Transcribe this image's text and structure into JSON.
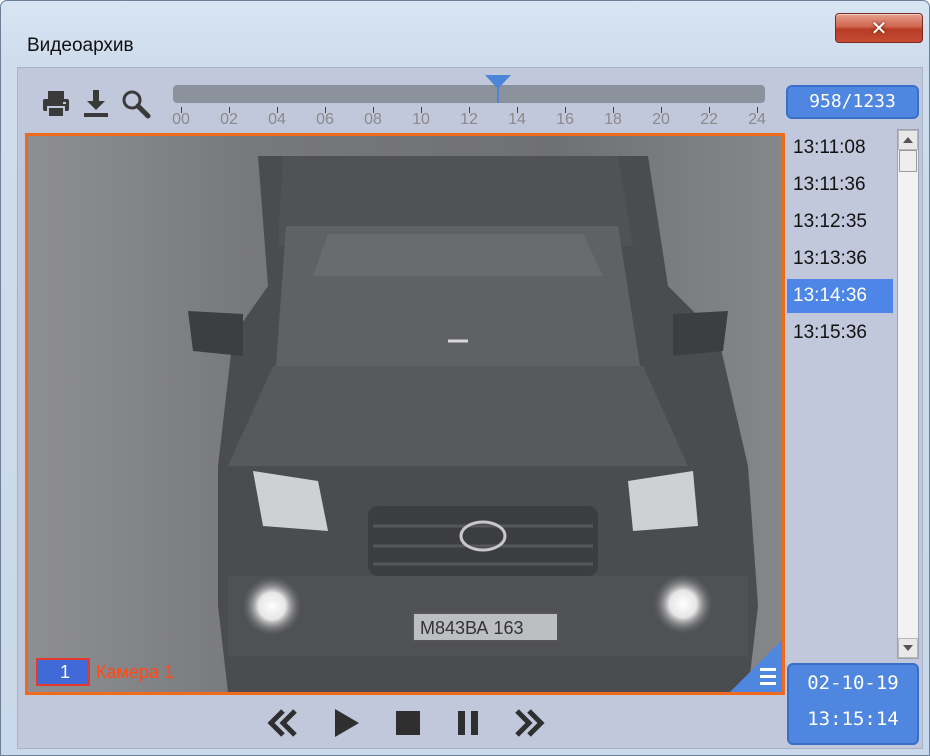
{
  "window": {
    "title": "Видеоархив",
    "close_label": "✕"
  },
  "toolbar": {
    "print_icon": "printer-icon",
    "download_icon": "download-icon",
    "search_icon": "search-icon"
  },
  "timeline": {
    "labels": [
      "00",
      "02",
      "04",
      "06",
      "08",
      "10",
      "12",
      "14",
      "16",
      "18",
      "20",
      "22",
      "24"
    ],
    "current_hour": 13.2
  },
  "counter": "958/1233",
  "camera": {
    "number": "1",
    "name": "Камера 1",
    "scene_plate": "М843ВА 163"
  },
  "times": [
    "13:11:08",
    "13:11:36",
    "13:12:35",
    "13:13:36",
    "13:14:36",
    "13:15:36"
  ],
  "selected_time_index": 4,
  "datetime": {
    "date": "02-10-19",
    "time": "13:15:14"
  },
  "controls": [
    "rewind-icon",
    "play-icon",
    "stop-icon",
    "pause-icon",
    "fast-forward-icon"
  ],
  "colors": {
    "accent": "#4f86e0",
    "frame": "#f06a1e",
    "camera_label": "#ff4a16"
  }
}
